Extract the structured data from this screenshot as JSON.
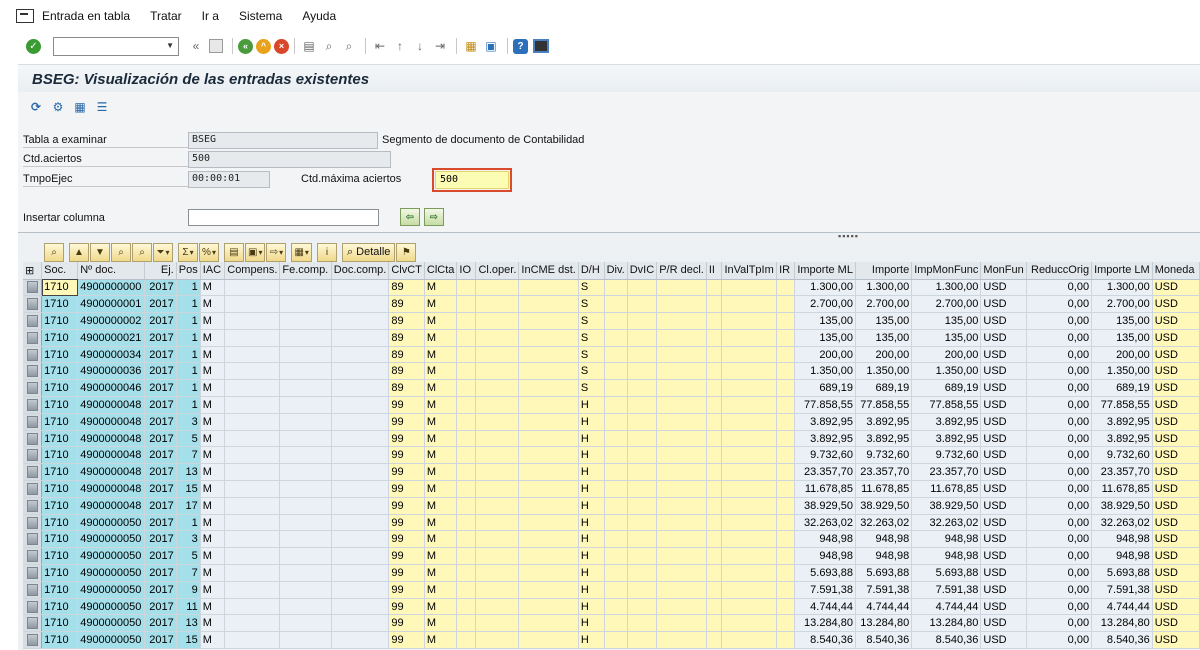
{
  "menu": [
    "Entrada en tabla",
    "Tratar",
    "Ir a",
    "Sistema",
    "Ayuda"
  ],
  "title": "BSEG: Visualización de las entradas existentes",
  "form": {
    "table_label": "Tabla a examinar",
    "table_value": "BSEG",
    "table_desc": "Segmento de documento de Contabilidad",
    "hits_label": "Ctd.aciertos",
    "hits_value": "500",
    "time_label": "TmpoEjec",
    "time_value": "00:00:01",
    "maxhits_label": "Ctd.máxima aciertos",
    "maxhits_value": "500",
    "insert_col_label": "Insertar columna"
  },
  "grid_toolbar": {
    "detail_label": "Detalle"
  },
  "columns": [
    "Soc.",
    "Nº doc.",
    "Ej.",
    "Pos",
    "IAC",
    "Compens.",
    "Fe.comp.",
    "Doc.comp.",
    "ClvCT",
    "ClCta",
    "IO",
    "Cl.oper.",
    "InCME dst.",
    "D/H",
    "Div.",
    "DvIC",
    "P/R decl.",
    "II",
    "InValTpIm",
    "IR",
    "Importe ML",
    "Importe",
    "ImpMonFunc",
    "MonFun",
    "ReduccOrig",
    "Importe LM",
    "Moneda"
  ],
  "rows": [
    [
      "1710",
      "4900000000",
      "2017",
      "1",
      "M",
      "",
      "",
      "",
      "89",
      "M",
      "",
      "",
      "",
      "S",
      "",
      "",
      "",
      "",
      "",
      "",
      "1.300,00",
      "1.300,00",
      "1.300,00",
      "USD",
      "0,00",
      "1.300,00",
      "USD"
    ],
    [
      "1710",
      "4900000001",
      "2017",
      "1",
      "M",
      "",
      "",
      "",
      "89",
      "M",
      "",
      "",
      "",
      "S",
      "",
      "",
      "",
      "",
      "",
      "",
      "2.700,00",
      "2.700,00",
      "2.700,00",
      "USD",
      "0,00",
      "2.700,00",
      "USD"
    ],
    [
      "1710",
      "4900000002",
      "2017",
      "1",
      "M",
      "",
      "",
      "",
      "89",
      "M",
      "",
      "",
      "",
      "S",
      "",
      "",
      "",
      "",
      "",
      "",
      "135,00",
      "135,00",
      "135,00",
      "USD",
      "0,00",
      "135,00",
      "USD"
    ],
    [
      "1710",
      "4900000021",
      "2017",
      "1",
      "M",
      "",
      "",
      "",
      "89",
      "M",
      "",
      "",
      "",
      "S",
      "",
      "",
      "",
      "",
      "",
      "",
      "135,00",
      "135,00",
      "135,00",
      "USD",
      "0,00",
      "135,00",
      "USD"
    ],
    [
      "1710",
      "4900000034",
      "2017",
      "1",
      "M",
      "",
      "",
      "",
      "89",
      "M",
      "",
      "",
      "",
      "S",
      "",
      "",
      "",
      "",
      "",
      "",
      "200,00",
      "200,00",
      "200,00",
      "USD",
      "0,00",
      "200,00",
      "USD"
    ],
    [
      "1710",
      "4900000036",
      "2017",
      "1",
      "M",
      "",
      "",
      "",
      "89",
      "M",
      "",
      "",
      "",
      "S",
      "",
      "",
      "",
      "",
      "",
      "",
      "1.350,00",
      "1.350,00",
      "1.350,00",
      "USD",
      "0,00",
      "1.350,00",
      "USD"
    ],
    [
      "1710",
      "4900000046",
      "2017",
      "1",
      "M",
      "",
      "",
      "",
      "89",
      "M",
      "",
      "",
      "",
      "S",
      "",
      "",
      "",
      "",
      "",
      "",
      "689,19",
      "689,19",
      "689,19",
      "USD",
      "0,00",
      "689,19",
      "USD"
    ],
    [
      "1710",
      "4900000048",
      "2017",
      "1",
      "M",
      "",
      "",
      "",
      "99",
      "M",
      "",
      "",
      "",
      "H",
      "",
      "",
      "",
      "",
      "",
      "",
      "77.858,55",
      "77.858,55",
      "77.858,55",
      "USD",
      "0,00",
      "77.858,55",
      "USD"
    ],
    [
      "1710",
      "4900000048",
      "2017",
      "3",
      "M",
      "",
      "",
      "",
      "99",
      "M",
      "",
      "",
      "",
      "H",
      "",
      "",
      "",
      "",
      "",
      "",
      "3.892,95",
      "3.892,95",
      "3.892,95",
      "USD",
      "0,00",
      "3.892,95",
      "USD"
    ],
    [
      "1710",
      "4900000048",
      "2017",
      "5",
      "M",
      "",
      "",
      "",
      "99",
      "M",
      "",
      "",
      "",
      "H",
      "",
      "",
      "",
      "",
      "",
      "",
      "3.892,95",
      "3.892,95",
      "3.892,95",
      "USD",
      "0,00",
      "3.892,95",
      "USD"
    ],
    [
      "1710",
      "4900000048",
      "2017",
      "7",
      "M",
      "",
      "",
      "",
      "99",
      "M",
      "",
      "",
      "",
      "H",
      "",
      "",
      "",
      "",
      "",
      "",
      "9.732,60",
      "9.732,60",
      "9.732,60",
      "USD",
      "0,00",
      "9.732,60",
      "USD"
    ],
    [
      "1710",
      "4900000048",
      "2017",
      "13",
      "M",
      "",
      "",
      "",
      "99",
      "M",
      "",
      "",
      "",
      "H",
      "",
      "",
      "",
      "",
      "",
      "",
      "23.357,70",
      "23.357,70",
      "23.357,70",
      "USD",
      "0,00",
      "23.357,70",
      "USD"
    ],
    [
      "1710",
      "4900000048",
      "2017",
      "15",
      "M",
      "",
      "",
      "",
      "99",
      "M",
      "",
      "",
      "",
      "H",
      "",
      "",
      "",
      "",
      "",
      "",
      "11.678,85",
      "11.678,85",
      "11.678,85",
      "USD",
      "0,00",
      "11.678,85",
      "USD"
    ],
    [
      "1710",
      "4900000048",
      "2017",
      "17",
      "M",
      "",
      "",
      "",
      "99",
      "M",
      "",
      "",
      "",
      "H",
      "",
      "",
      "",
      "",
      "",
      "",
      "38.929,50",
      "38.929,50",
      "38.929,50",
      "USD",
      "0,00",
      "38.929,50",
      "USD"
    ],
    [
      "1710",
      "4900000050",
      "2017",
      "1",
      "M",
      "",
      "",
      "",
      "99",
      "M",
      "",
      "",
      "",
      "H",
      "",
      "",
      "",
      "",
      "",
      "",
      "32.263,02",
      "32.263,02",
      "32.263,02",
      "USD",
      "0,00",
      "32.263,02",
      "USD"
    ],
    [
      "1710",
      "4900000050",
      "2017",
      "3",
      "M",
      "",
      "",
      "",
      "99",
      "M",
      "",
      "",
      "",
      "H",
      "",
      "",
      "",
      "",
      "",
      "",
      "948,98",
      "948,98",
      "948,98",
      "USD",
      "0,00",
      "948,98",
      "USD"
    ],
    [
      "1710",
      "4900000050",
      "2017",
      "5",
      "M",
      "",
      "",
      "",
      "99",
      "M",
      "",
      "",
      "",
      "H",
      "",
      "",
      "",
      "",
      "",
      "",
      "948,98",
      "948,98",
      "948,98",
      "USD",
      "0,00",
      "948,98",
      "USD"
    ],
    [
      "1710",
      "4900000050",
      "2017",
      "7",
      "M",
      "",
      "",
      "",
      "99",
      "M",
      "",
      "",
      "",
      "H",
      "",
      "",
      "",
      "",
      "",
      "",
      "5.693,88",
      "5.693,88",
      "5.693,88",
      "USD",
      "0,00",
      "5.693,88",
      "USD"
    ],
    [
      "1710",
      "4900000050",
      "2017",
      "9",
      "M",
      "",
      "",
      "",
      "99",
      "M",
      "",
      "",
      "",
      "H",
      "",
      "",
      "",
      "",
      "",
      "",
      "7.591,38",
      "7.591,38",
      "7.591,38",
      "USD",
      "0,00",
      "7.591,38",
      "USD"
    ],
    [
      "1710",
      "4900000050",
      "2017",
      "11",
      "M",
      "",
      "",
      "",
      "99",
      "M",
      "",
      "",
      "",
      "H",
      "",
      "",
      "",
      "",
      "",
      "",
      "4.744,44",
      "4.744,44",
      "4.744,44",
      "USD",
      "0,00",
      "4.744,44",
      "USD"
    ],
    [
      "1710",
      "4900000050",
      "2017",
      "13",
      "M",
      "",
      "",
      "",
      "99",
      "M",
      "",
      "",
      "",
      "H",
      "",
      "",
      "",
      "",
      "",
      "",
      "13.284,80",
      "13.284,80",
      "13.284,80",
      "USD",
      "0,00",
      "13.284,80",
      "USD"
    ],
    [
      "1710",
      "4900000050",
      "2017",
      "15",
      "M",
      "",
      "",
      "",
      "99",
      "M",
      "",
      "",
      "",
      "H",
      "",
      "",
      "",
      "",
      "",
      "",
      "8.540,36",
      "8.540,36",
      "8.540,36",
      "USD",
      "0,00",
      "8.540,36",
      "USD"
    ]
  ]
}
